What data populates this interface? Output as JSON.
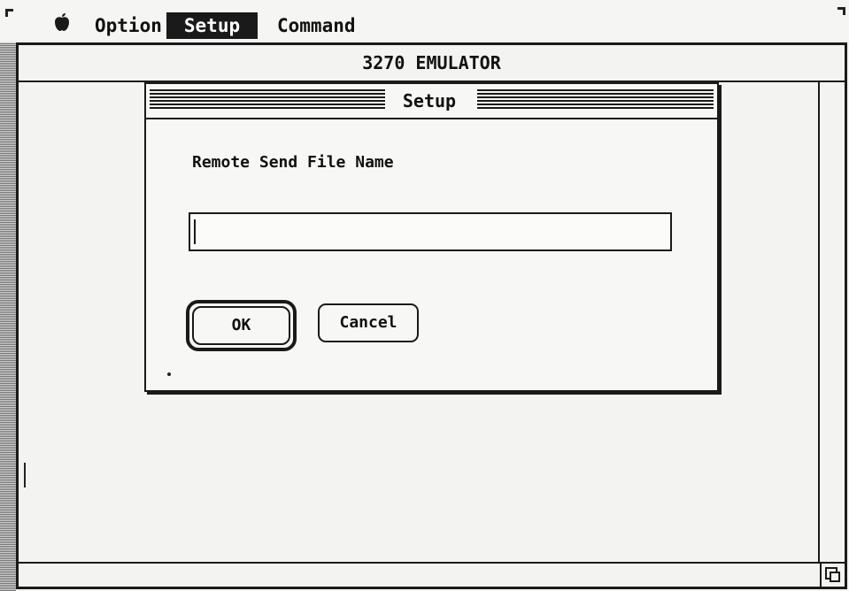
{
  "menubar": {
    "apple_icon": "apple-icon",
    "items": [
      {
        "label": "Option"
      },
      {
        "label": "Setup",
        "active": true
      },
      {
        "label": "Command"
      }
    ]
  },
  "window": {
    "title": "3270 EMULATOR"
  },
  "dialog": {
    "title": "Setup",
    "field_label": "Remote Send File Name",
    "field_value": "",
    "ok_label": "OK",
    "cancel_label": "Cancel"
  },
  "colors": {
    "background": "#f3f3f1",
    "ink": "#1a1a1a",
    "menu_highlight": "#1a1a1a"
  }
}
